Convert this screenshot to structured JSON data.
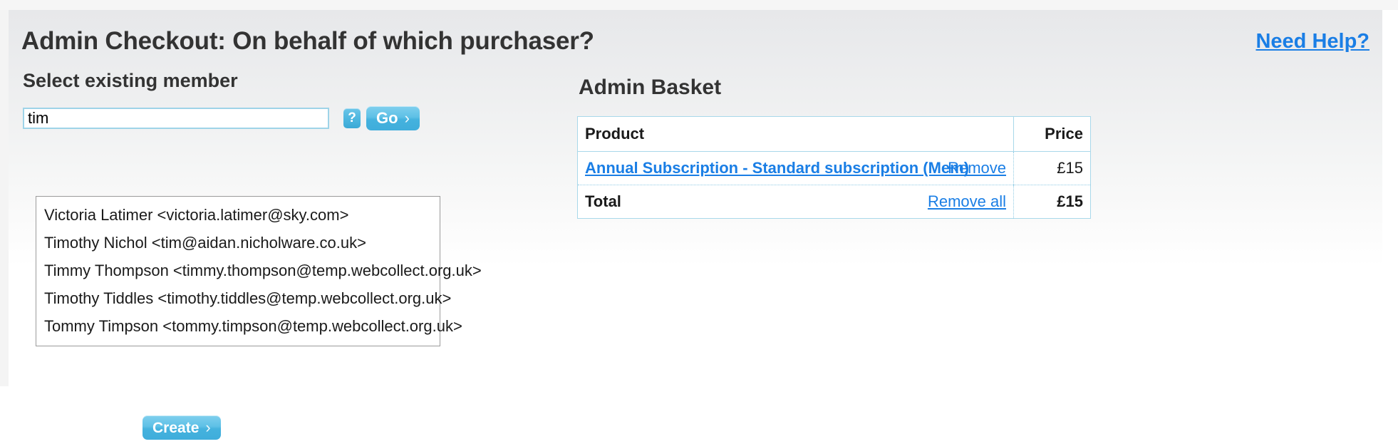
{
  "header": {
    "title": "Admin Checkout: On behalf of which purchaser?",
    "help_link": "Need Help?"
  },
  "member_select": {
    "heading": "Select existing member",
    "search_value": "tim",
    "search_placeholder": "",
    "help_icon_label": "?",
    "go_button": "Go",
    "chevron": "›",
    "create_button": "Create",
    "suggestions": [
      "Victoria Latimer <victoria.latimer@sky.com>",
      "Timothy Nichol <tim@aidan.nicholware.co.uk>",
      "Timmy Thompson <timmy.thompson@temp.webcollect.org.uk>",
      "Timothy Tiddles <timothy.tiddles@temp.webcollect.org.uk>",
      "Tommy Timpson <tommy.timpson@temp.webcollect.org.uk>"
    ]
  },
  "basket": {
    "title": "Admin Basket",
    "columns": {
      "product": "Product",
      "price": "Price"
    },
    "items": [
      {
        "product": "Annual Subscription - Standard subscription (Mem)",
        "remove": "Remove",
        "price": "£15"
      }
    ],
    "total": {
      "label": "Total",
      "remove_all": "Remove all",
      "price": "£15"
    }
  },
  "colors": {
    "accent_blue": "#1a7ee5",
    "button_blue": "#4fb8e0",
    "table_border": "#a8d8ea",
    "heading_text": "#333333"
  }
}
